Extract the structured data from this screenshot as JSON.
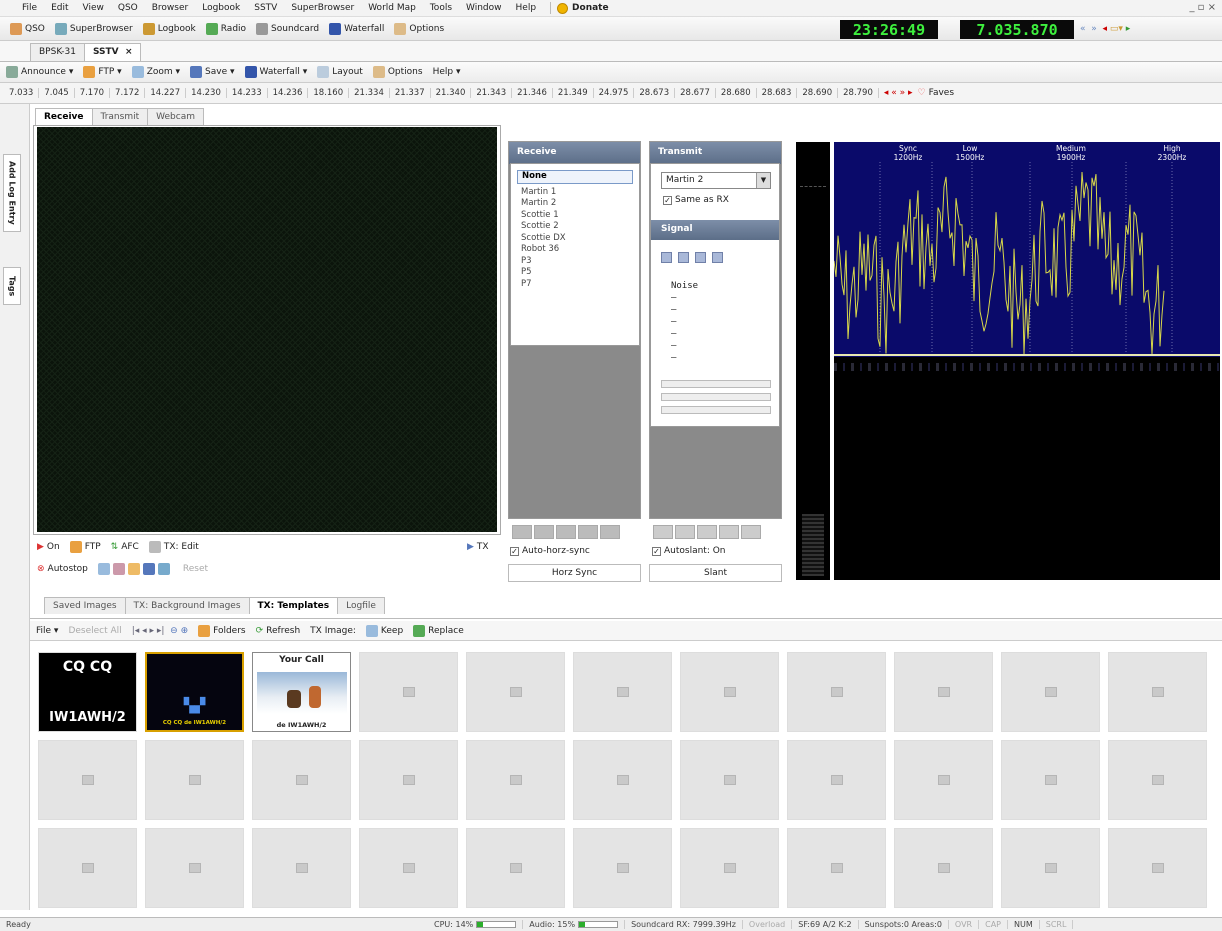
{
  "menubar": {
    "items": [
      "File",
      "Edit",
      "View",
      "QSO",
      "Browser",
      "Logbook",
      "SSTV",
      "SuperBrowser",
      "World Map",
      "Tools",
      "Window",
      "Help"
    ],
    "donate_label": "Donate"
  },
  "toolbar1": {
    "items": [
      "QSO",
      "SuperBrowser",
      "Logbook",
      "Radio",
      "Soundcard",
      "Waterfall",
      "Options"
    ],
    "clock": "23:26:49",
    "frequency": "7.035.870"
  },
  "doc_tabs": [
    "BPSK-31",
    "SSTV"
  ],
  "toolbar2": {
    "items": [
      "Announce",
      "FTP",
      "Zoom",
      "Save",
      "Waterfall",
      "Layout",
      "Options",
      "Help"
    ]
  },
  "frequencies": [
    "7.033",
    "7.045",
    "7.170",
    "7.172",
    "14.227",
    "14.230",
    "14.233",
    "14.236",
    "18.160",
    "21.334",
    "21.337",
    "21.340",
    "21.343",
    "21.346",
    "21.349",
    "24.975",
    "28.673",
    "28.677",
    "28.680",
    "28.683",
    "28.690",
    "28.790"
  ],
  "faves_label": "Faves",
  "side_tabs": [
    "Add Log Entry",
    "Tags"
  ],
  "panel_tabs": [
    "Receive",
    "Transmit",
    "Webcam"
  ],
  "rx_controls": {
    "row1": [
      "On",
      "FTP",
      "AFC",
      "TX: Edit"
    ],
    "tx_label": "TX",
    "row2": [
      "Autostop",
      "Reset"
    ]
  },
  "receive_panel": {
    "title": "Receive",
    "modes": [
      "None",
      "Martin 1",
      "Martin 2",
      "Scottie 1",
      "Scottie 2",
      "Scottie DX",
      "Robot 36",
      "P3",
      "P5",
      "P7"
    ],
    "auto_horz_label": "Auto-horz-sync",
    "horz_sync_label": "Horz Sync"
  },
  "transmit_panel": {
    "title": "Transmit",
    "mode": "Martin 2",
    "same_as_rx_label": "Same as RX",
    "signal_title": "Signal",
    "signal_value": "Noise",
    "auto_slant_label": "Autoslant: On",
    "slant_label": "Slant"
  },
  "spectrum": {
    "markers": [
      {
        "name": "Sync",
        "freq": "1200Hz"
      },
      {
        "name": "Low",
        "freq": "1500Hz"
      },
      {
        "name": "Medium",
        "freq": "1900Hz"
      },
      {
        "name": "High",
        "freq": "2300Hz"
      }
    ]
  },
  "lower_tabs": [
    "Saved Images",
    "TX: Background Images",
    "TX: Templates",
    "Logfile"
  ],
  "lower_toolbar": {
    "items": [
      "File",
      "Deselect All",
      "Folders",
      "Refresh",
      "TX Image:",
      "Keep",
      "Replace"
    ]
  },
  "templates": [
    {
      "top": "CQ CQ",
      "bottom": "IW1AWH/2"
    },
    {
      "top": "",
      "bottom": "CQ CQ de IW1AWH/2"
    },
    {
      "top": "Your Call",
      "bottom": "de IW1AWH/2"
    }
  ],
  "statusbar": {
    "ready": "Ready",
    "cpu": "CPU: 14%",
    "cpu_pct": 14,
    "audio": "Audio: 15%",
    "audio_pct": 15,
    "soundcard": "Soundcard RX: 7999.39Hz",
    "overload": "Overload",
    "sf": "SF:69 A/2 K:2",
    "sunspots": "Sunspots:0 Areas:0",
    "ovr": "OVR",
    "cap": "CAP",
    "num": "NUM",
    "scrl": "SCRL"
  },
  "colors": {
    "display_bg": "#0a0a0a",
    "display_fg": "#3ef03e",
    "spectrum_bg": "#0a0a6a",
    "spectrum_trace": "#d8d84a",
    "panel_header": "#6a7c96"
  }
}
